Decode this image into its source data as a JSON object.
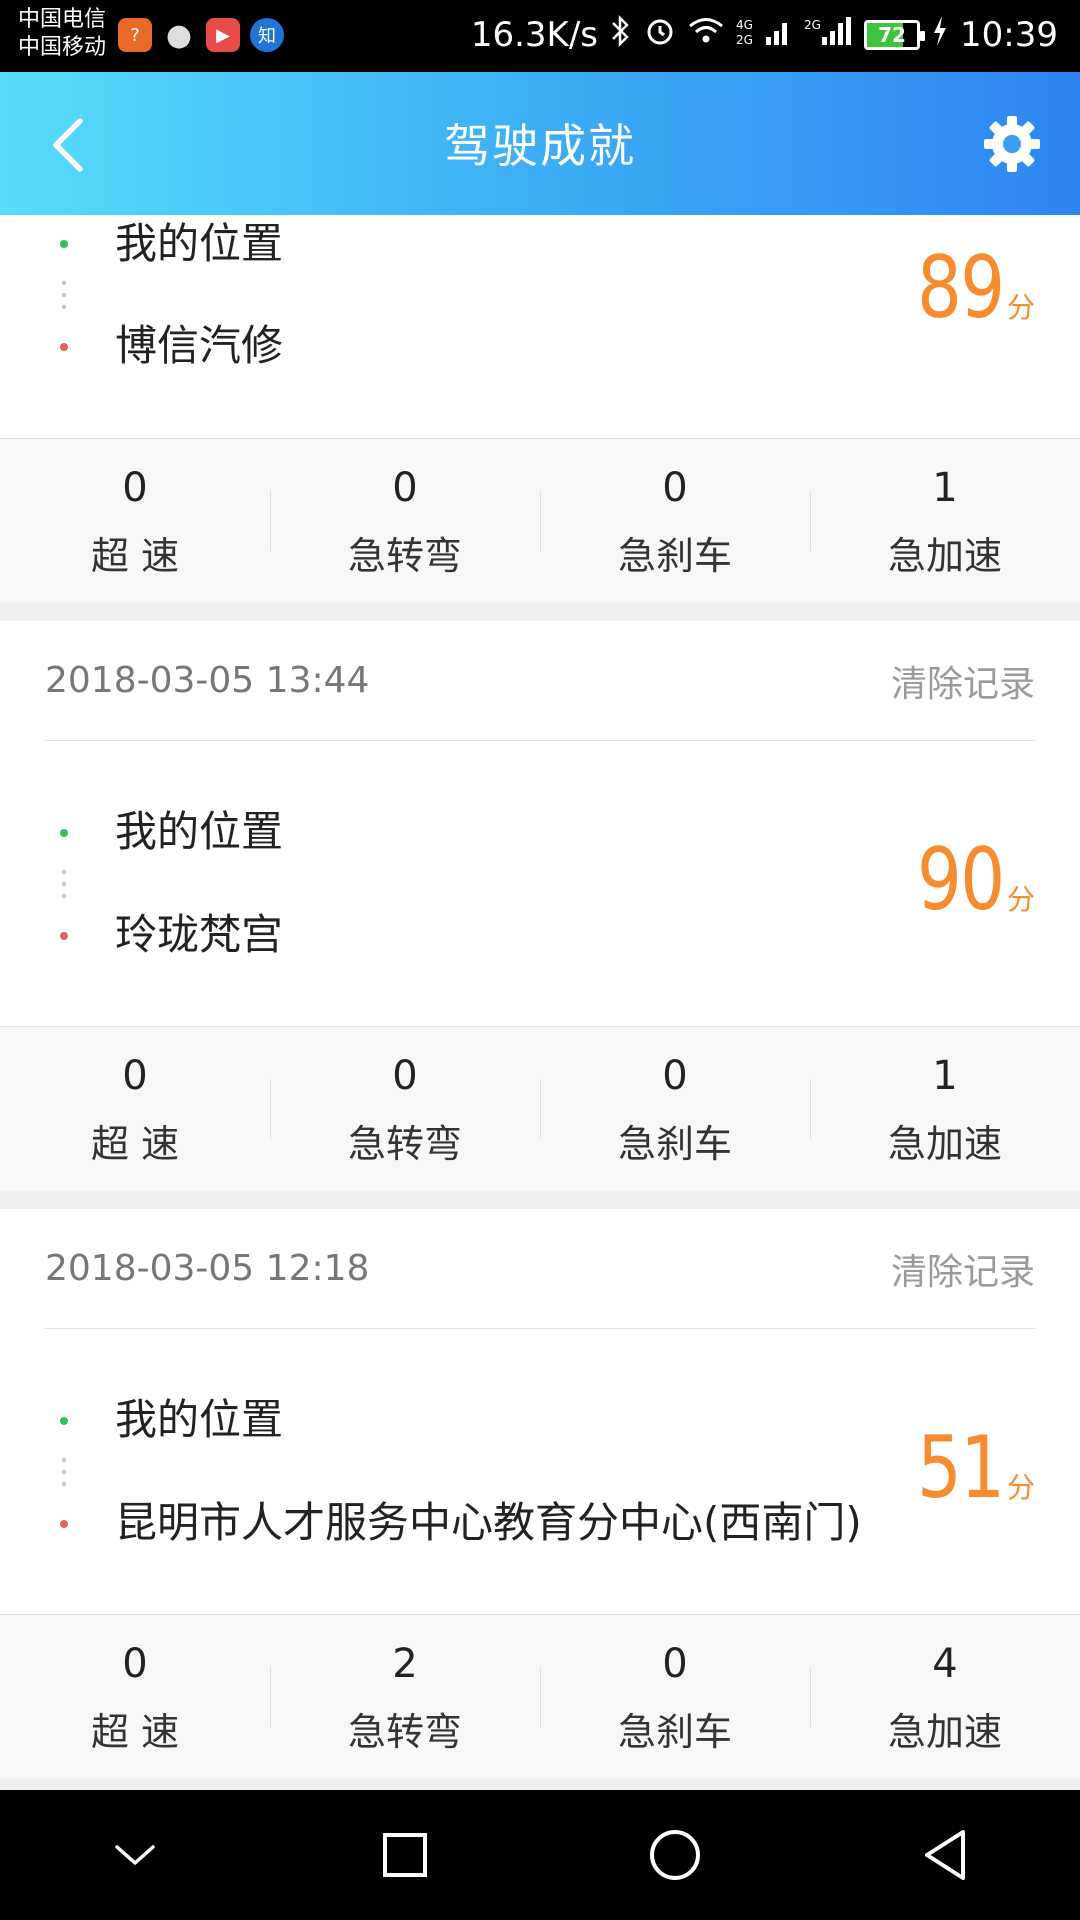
{
  "status_bar": {
    "carrier_1": "中国电信",
    "carrier_2": "中国移动",
    "network_speed": "16.3K/s",
    "battery_level": "72",
    "time": "10:39",
    "badge_zhihu": "知"
  },
  "header": {
    "title": "驾驶成就"
  },
  "trips": [
    {
      "date": "",
      "clear_label": "",
      "start": "我的位置",
      "end": "博信汽修",
      "score": "89",
      "score_unit": "分",
      "stats": [
        {
          "value": "0",
          "label": "超 速"
        },
        {
          "value": "0",
          "label": "急转弯"
        },
        {
          "value": "0",
          "label": "急刹车"
        },
        {
          "value": "1",
          "label": "急加速"
        }
      ]
    },
    {
      "date": "2018-03-05  13:44",
      "clear_label": "清除记录",
      "start": "我的位置",
      "end": "玲珑梵宫",
      "score": "90",
      "score_unit": "分",
      "stats": [
        {
          "value": "0",
          "label": "超 速"
        },
        {
          "value": "0",
          "label": "急转弯"
        },
        {
          "value": "0",
          "label": "急刹车"
        },
        {
          "value": "1",
          "label": "急加速"
        }
      ]
    },
    {
      "date": "2018-03-05  12:18",
      "clear_label": "清除记录",
      "start": "我的位置",
      "end": "昆明市人才服务中心教育分中心(西南门)",
      "score": "51",
      "score_unit": "分",
      "stats": [
        {
          "value": "0",
          "label": "超 速"
        },
        {
          "value": "2",
          "label": "急转弯"
        },
        {
          "value": "0",
          "label": "急刹车"
        },
        {
          "value": "4",
          "label": "急加速"
        }
      ]
    }
  ],
  "colors": {
    "score": "#f68b2f",
    "header_start": "#56dcfb",
    "header_end": "#2e86f2"
  }
}
